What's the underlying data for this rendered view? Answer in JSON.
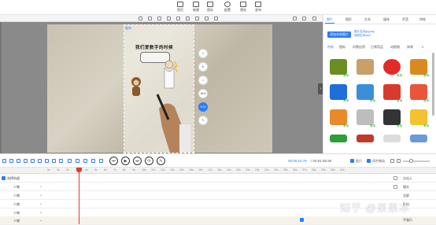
{
  "toolbar": {
    "items": [
      {
        "label": "首页",
        "icon": "home-icon"
      },
      {
        "label": "新建",
        "icon": "new-file-icon"
      },
      {
        "label": "保存",
        "icon": "save-icon"
      },
      {
        "label": "配置",
        "icon": "settings-icon"
      },
      {
        "label": "预览",
        "icon": "preview-icon"
      },
      {
        "label": "发布",
        "icon": "publish-icon"
      }
    ]
  },
  "canvas": {
    "frame_tag": "画布",
    "title_text": "我们爱数字的时候",
    "side_tools": [
      "1:1",
      "9:16",
      "16:9"
    ],
    "side_active_label": "9:16",
    "side_16_9": "16:9"
  },
  "right_panel": {
    "tabs": [
      "图片",
      "图形",
      "文本",
      "媒体",
      "声音",
      "特效"
    ],
    "upload_button": "添加本地图片",
    "upload_note_1": "图片支持jpg,png",
    "upload_note_2": "视频支持mp4",
    "categories": [
      "所有",
      "图标",
      "风景自然",
      "日常用品",
      "动植物",
      "体育",
      "人"
    ],
    "badge": "常用"
  },
  "controls": {
    "time_current": "00:00:10.79",
    "time_total": "/ 00:01:55.50",
    "label_snap": "贴尺",
    "label_sync": "同步移动"
  },
  "timeline": {
    "selected_label": "选择轨道",
    "ticks": [
      "0s",
      "1s",
      "2s",
      "3s",
      "4s",
      "5s",
      "6s",
      "7s",
      "8s",
      "9s",
      "10s",
      "11s",
      "12s",
      "13s",
      "14s",
      "15s",
      "16s",
      "17s",
      "18s",
      "19s",
      "20s",
      "21s",
      "22s",
      "23s",
      "24s",
      "25s",
      "26s",
      "27s",
      "28s",
      "29s",
      "30s",
      "31s"
    ],
    "rows": [
      "人物",
      "人物",
      "人物",
      "人物",
      "人物"
    ],
    "row_end_labels": [
      "点击入",
      "镜头",
      "全屏",
      "移出",
      "手画行"
    ]
  },
  "watermark": "知乎 @果果冰"
}
